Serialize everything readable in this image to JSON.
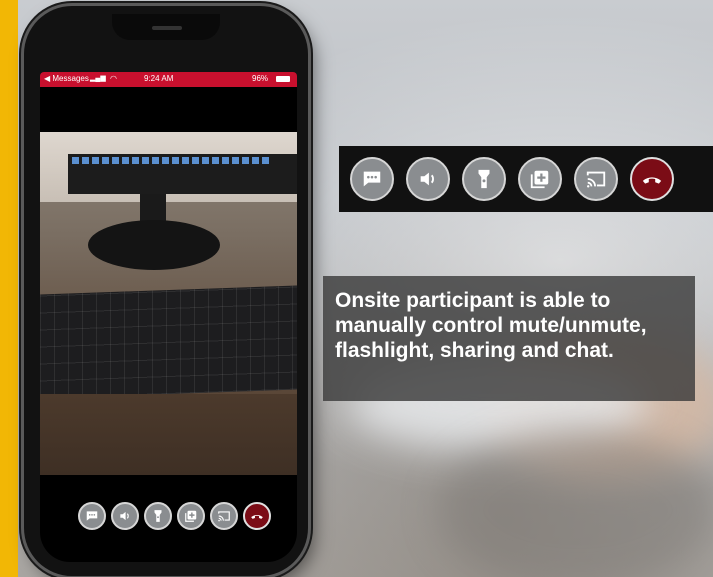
{
  "status_bar": {
    "back_app": "◀ Messages",
    "signal": "▂▄▆",
    "wifi": "◠",
    "time": "9:24 AM",
    "battery": "96%"
  },
  "controls": [
    {
      "id": "chat",
      "icon": "chat-icon"
    },
    {
      "id": "volume",
      "icon": "speaker-icon"
    },
    {
      "id": "flashlight",
      "icon": "flashlight-icon"
    },
    {
      "id": "add",
      "icon": "add-square-icon"
    },
    {
      "id": "cast",
      "icon": "cast-icon"
    },
    {
      "id": "end",
      "icon": "hang-up-icon"
    }
  ],
  "caption": {
    "line1": "Onsite participant is able to",
    "line2": "manually control mute/unmute,",
    "line3": "flashlight, sharing and chat."
  },
  "colors": {
    "frame": "#f2b705",
    "status_bar": "#c8102e",
    "end_call": "#7b0c16",
    "button": "#8a8d90"
  }
}
